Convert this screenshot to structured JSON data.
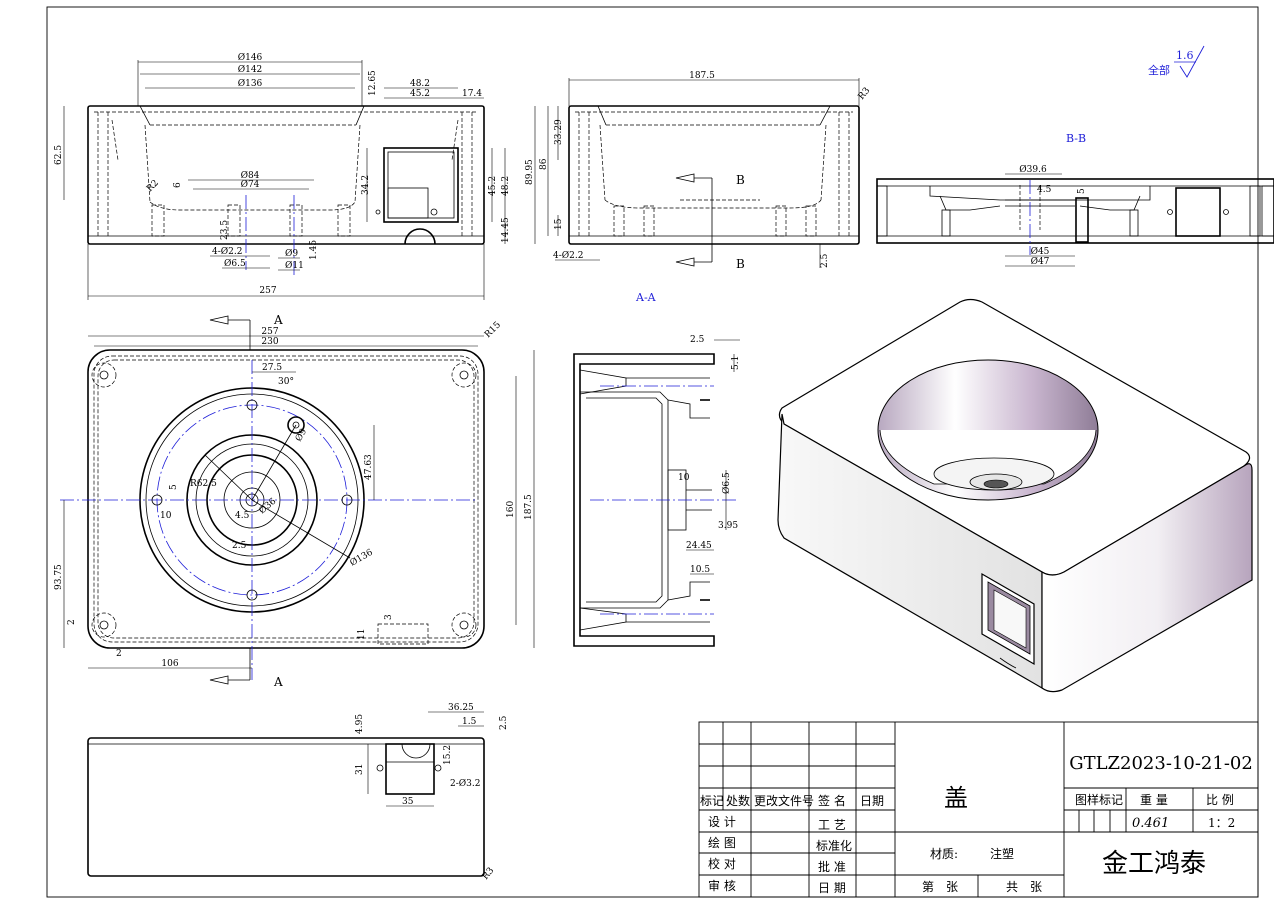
{
  "part_name": "盖",
  "drawing_number": "GTLZ2023-10-21-02",
  "company": "金工鸿泰",
  "material_label": "材质:",
  "material_value": "注塑",
  "weight_value": "0.461",
  "scale_value": "1：2",
  "surface_finish": {
    "prefix": "全部",
    "value": "1.6"
  },
  "title_block": {
    "rev_headers": [
      "标记",
      "处数",
      "更改文件号",
      "签 名",
      "日期"
    ],
    "left_roles": [
      "设 计",
      "绘 图",
      "校 对",
      "审 核"
    ],
    "mid_roles": [
      "工 艺",
      "标准化",
      "批 准",
      "日 期"
    ],
    "attr_headers": [
      "图样标记",
      "重 量",
      "比 例"
    ],
    "sheet_label": "第　张",
    "sheets_total_label": "共　张"
  },
  "section_labels": {
    "a_top": "A",
    "a_bottom": "A",
    "b_top": "B",
    "b_bottom": "B",
    "aa_title": "A-A",
    "bb_title": "B-B"
  },
  "dims": {
    "front": [
      "Ø146",
      "Ø142",
      "Ø136",
      "12.65",
      "48.2",
      "45.2",
      "17.4",
      "62.5",
      "Ø84",
      "Ø74",
      "R2",
      "6",
      "23.5",
      "34.2",
      "45.2",
      "48.2",
      "14.45",
      "4-Ø2.2",
      "Ø6.5",
      "Ø9",
      "Ø11",
      "1.45",
      "257"
    ],
    "section_aa": [
      "187.5",
      "R3",
      "33.29",
      "86",
      "89.95",
      "15",
      "4-Ø2.2",
      "2.5"
    ],
    "section_bb": [
      "Ø39.6",
      "4.5",
      "5",
      "Ø45",
      "Ø47"
    ],
    "top": [
      "257",
      "230",
      "R15",
      "27.5",
      "30°",
      "Ø9",
      "47.63",
      "R62.5",
      "5",
      "10",
      "4.5",
      "2.5",
      "Ø36",
      "Ø136",
      "160",
      "187.5",
      "93.75",
      "2",
      "2",
      "106",
      "3",
      "11"
    ],
    "side": [
      "2.5",
      "5.1",
      "Ø6.5",
      "10",
      "3.95",
      "24.45",
      "10.5"
    ],
    "back": [
      "36.25",
      "1.5",
      "2.5",
      "4.95",
      "31",
      "15.2",
      "2-Ø3.2",
      "35",
      "R3"
    ]
  }
}
